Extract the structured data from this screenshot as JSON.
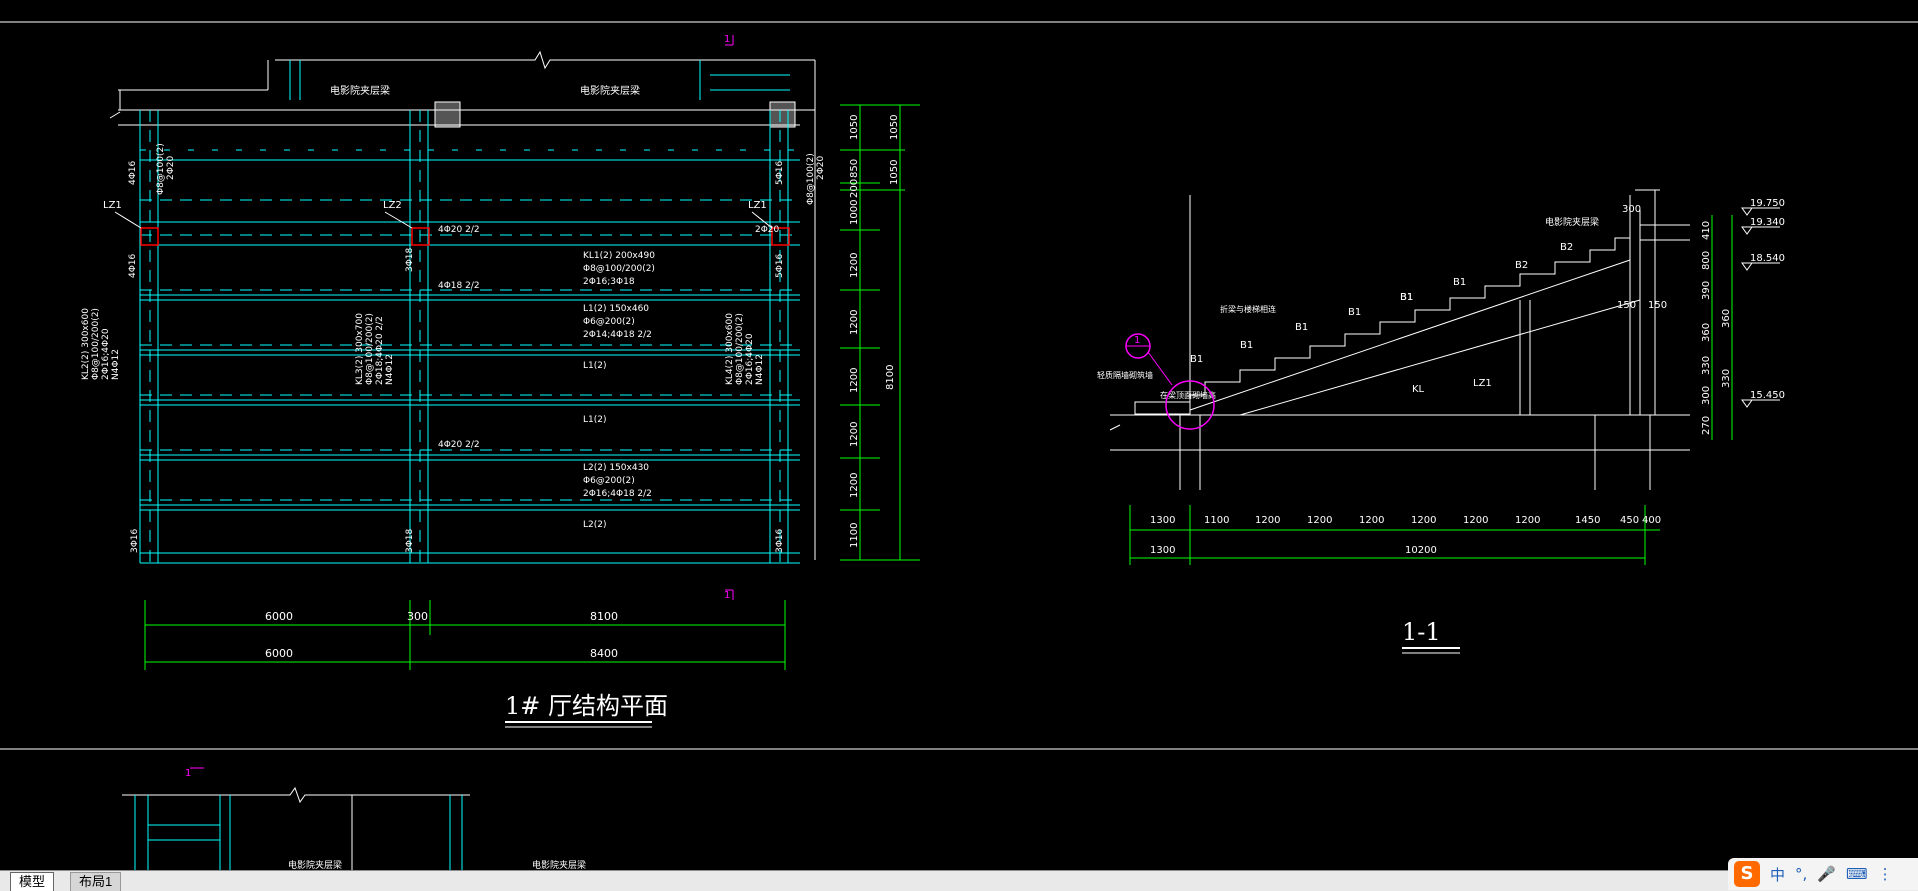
{
  "plan": {
    "title": "1# 厅结构平面",
    "beam_labels": [
      "电影院夹层梁",
      "电影院夹层梁"
    ],
    "column_labels": [
      "LZ1",
      "LZ2",
      "LZ1"
    ],
    "rebar_notes": [
      "4Φ20 2/2",
      "4Φ18 2/2",
      "4Φ20 2/2",
      "2Φ20",
      "KL1(2) 200x490",
      "Φ8@100/200(2)",
      "2Φ16;3Φ18",
      "L1(2) 150x460",
      "Φ6@200(2)",
      "2Φ14;4Φ18 2/2",
      "L1(2)",
      "L1(2)",
      "L2(2) 150x430",
      "Φ6@200(2)",
      "2Φ16;4Φ18 2/2",
      "L2(2)",
      "KL2(2) 300x600",
      "Φ8@100/200(2)",
      "2Φ16;4Φ20",
      "N4Φ12",
      "KL3(2) 300x700",
      "Φ8@100/200(2)",
      "2Φ18;4Φ20 2/2",
      "N4Φ12",
      "KL4(2) 300x600",
      "Φ8@100/200(2)",
      "2Φ16;4Φ20",
      "N4Φ12",
      "Φ8@100(2)",
      "2Φ20",
      "4Φ16",
      "4Φ16",
      "3Φ16",
      "3Φ18",
      "3Φ16",
      "3Φ18",
      "5Φ16",
      "5Φ16"
    ],
    "right_dims_1": [
      "1050",
      "850",
      "200",
      "1000",
      "1200",
      "1200",
      "1200",
      "1200",
      "1200",
      "1100"
    ],
    "right_dims_2": [
      "1050",
      "1050",
      "8100"
    ],
    "bottom_dims_1": [
      "6000",
      "300",
      "8100"
    ],
    "bottom_dims_2": [
      "6000",
      "8400"
    ],
    "section_mark_top": "1",
    "section_mark_bottom": "1"
  },
  "section": {
    "title": "1-1",
    "callout_number": "1",
    "labels": [
      "电影院夹层梁",
      "B2",
      "B2",
      "B1",
      "B1",
      "B1",
      "B1",
      "B1",
      "B1",
      "B1",
      "KL",
      "LZ1",
      "折梁与楼梯相连",
      "在梁顶面砌墙高",
      "轻质隔墙砌筑墙"
    ],
    "elevations": [
      "19.750",
      "19.340",
      "18.540",
      "15.450"
    ],
    "right_dims": [
      "410",
      "800",
      "390",
      "360",
      "360",
      "330",
      "330",
      "270",
      "300"
    ],
    "top_dim": "300",
    "side_dims": [
      "150",
      "150"
    ],
    "bottom_dims_1": [
      "1300",
      "1100",
      "1200",
      "1200",
      "1200",
      "1200",
      "1200",
      "1200",
      "1450",
      "450",
      "400"
    ],
    "bottom_dims_2": [
      "1300",
      "10200"
    ]
  },
  "lower_view": {
    "section_mark": "1",
    "beam_labels": [
      "电影院夹层梁",
      "电影院夹层梁"
    ]
  },
  "tabs": {
    "model": "模型",
    "layout1": "布局1"
  },
  "ime": {
    "logo": "S",
    "lang": "中",
    "punct": "°,",
    "mic": "🎤",
    "keyboard": "⌨",
    "menu": "⋮"
  },
  "colors": {
    "background": "#000000",
    "cyan": "#00ffff",
    "green": "#00ff00",
    "white": "#ffffff",
    "magenta": "#ff00ff",
    "red": "#ff0000"
  }
}
